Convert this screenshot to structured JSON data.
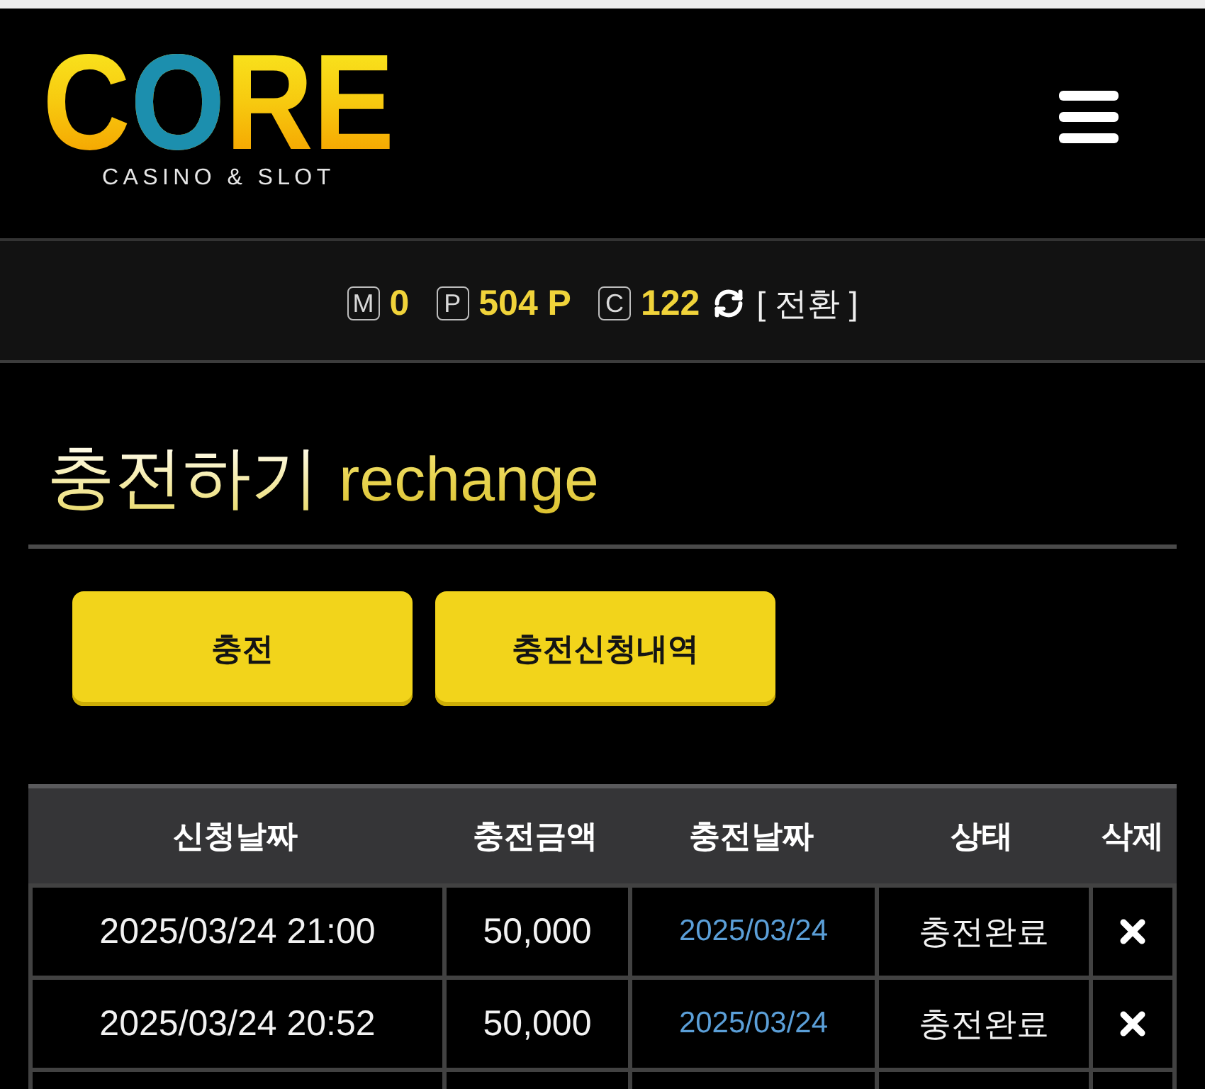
{
  "logo": {
    "wordmark": "CORE",
    "tagline": "CASINO & SLOT"
  },
  "balances": [
    {
      "badge": "M",
      "value": "0"
    },
    {
      "badge": "P",
      "value": "504 P"
    },
    {
      "badge": "C",
      "value": "122"
    }
  ],
  "switch_link": "[ 전환 ]",
  "title": {
    "heading": "충전하기",
    "subheading": "rechange"
  },
  "buttons": [
    "충전",
    "충전신청내역"
  ],
  "table": {
    "columns": [
      "신청날짜",
      "충전금액",
      "충전날짜",
      "상태",
      "삭제"
    ],
    "rows": [
      {
        "requested": "2025/03/24 21:00",
        "amount": "50,000",
        "charged": "2025/03/24",
        "status": "충전완료"
      },
      {
        "requested": "2025/03/24 20:52",
        "amount": "50,000",
        "charged": "2025/03/24",
        "status": "충전완료"
      }
    ]
  }
}
